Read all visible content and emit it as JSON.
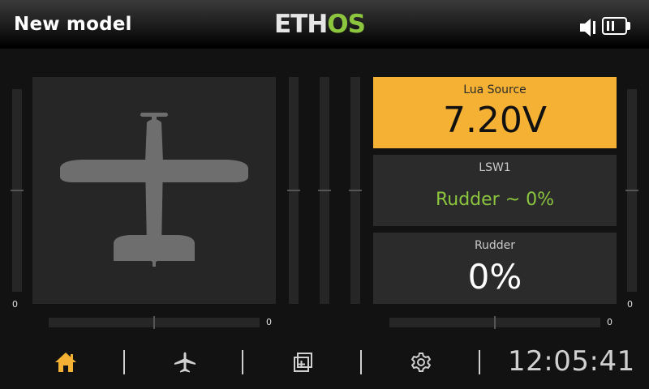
{
  "header": {
    "model_name": "New model",
    "logo_left": "ETH",
    "logo_right": "OS",
    "icons": [
      "speaker-icon",
      "battery-icon"
    ]
  },
  "trims": {
    "left_vertical_value": "0",
    "left_horizontal_value": "0",
    "right_horizontal_value": "0",
    "right_vertical_value": "0"
  },
  "model_image": {
    "icon": "airplane-silhouette-icon"
  },
  "widgets": [
    {
      "title": "Lua Source",
      "value": "7.20V",
      "highlight": true
    },
    {
      "title": "LSW1",
      "value": "Rudder ~ 0%",
      "value_color": "#8cc63f"
    },
    {
      "title": "Rudder",
      "value": "0%"
    }
  ],
  "nav": {
    "items": [
      {
        "icon": "home-icon",
        "active": true
      },
      {
        "icon": "airplane-icon"
      },
      {
        "icon": "widgets-icon"
      },
      {
        "icon": "gear-icon"
      }
    ],
    "clock": "12:05:41"
  },
  "colors": {
    "accent_orange": "#f5b133",
    "accent_green": "#8cc63f",
    "background": "#121212",
    "panel": "#262626"
  }
}
